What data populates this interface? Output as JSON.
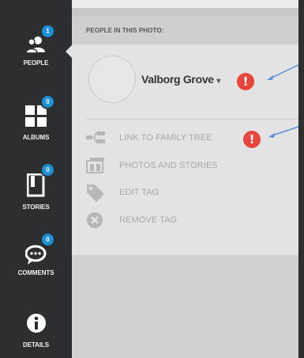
{
  "sidebar": {
    "items": [
      {
        "label": "PEOPLE",
        "icon": "people-icon",
        "badge": "1"
      },
      {
        "label": "ALBUMS",
        "icon": "albums-icon",
        "badge": "0"
      },
      {
        "label": "STORIES",
        "icon": "stories-icon",
        "badge": "0"
      },
      {
        "label": "COMMENTS",
        "icon": "comments-icon",
        "badge": "0"
      },
      {
        "label": "DETAILS",
        "icon": "info-icon",
        "badge": null
      }
    ]
  },
  "panel": {
    "header": "PEOPLE IN THIS PHOTO:",
    "person": {
      "name": "Valborg Grove",
      "caret": "▾",
      "alert": "!"
    },
    "actions": [
      {
        "label": "LINK TO FAMILY TREE",
        "icon": "family-tree-icon",
        "alert": "!"
      },
      {
        "label": "PHOTOS AND STORIES",
        "icon": "photos-stories-icon"
      },
      {
        "label": "EDIT TAG",
        "icon": "tag-icon"
      },
      {
        "label": "REMOVE TAG",
        "icon": "remove-icon"
      }
    ]
  },
  "colors": {
    "sidebar": "#2b2f31",
    "badge": "#1e90d6",
    "alert": "#e8453c",
    "annotation_arrow": "#5b8fd6"
  }
}
